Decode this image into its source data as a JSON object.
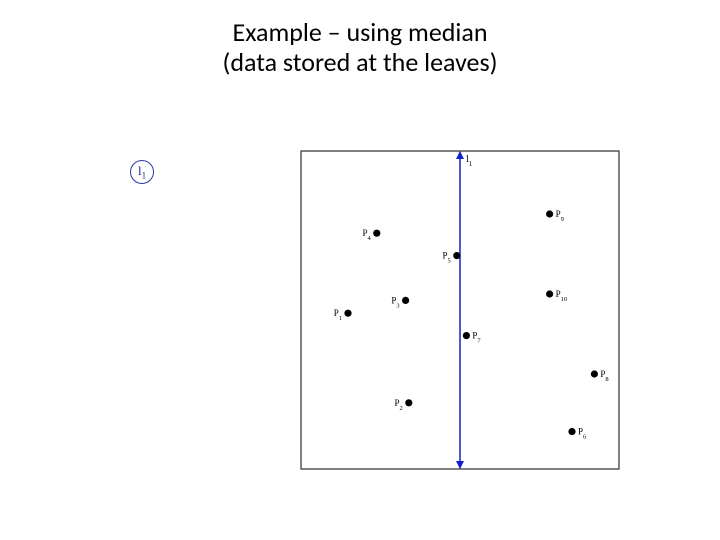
{
  "title_line1": "Example – using median",
  "title_line2": "(data stored at the leaves)",
  "tree": {
    "root_label_main": "l",
    "root_label_sub": "1"
  },
  "chart_data": {
    "type": "scatter",
    "title": "",
    "xlabel": "",
    "ylabel": "",
    "xlim": [
      0,
      100
    ],
    "ylim": [
      0,
      100
    ],
    "splits": [
      {
        "name": "l1",
        "axis": "x",
        "value": 50,
        "label_main": "l",
        "label_sub": "1"
      }
    ],
    "points": [
      {
        "name": "P1",
        "x": 15,
        "y": 49,
        "label_main": "P",
        "label_sub": "1",
        "label_side": "left"
      },
      {
        "name": "P2",
        "x": 34,
        "y": 21,
        "label_main": "P",
        "label_sub": "2",
        "label_side": "left"
      },
      {
        "name": "P3",
        "x": 33,
        "y": 53,
        "label_main": "P",
        "label_sub": "3",
        "label_side": "left"
      },
      {
        "name": "P4",
        "x": 24,
        "y": 74,
        "label_main": "P",
        "label_sub": "4",
        "label_side": "left"
      },
      {
        "name": "P5",
        "x": 49,
        "y": 67,
        "label_main": "P",
        "label_sub": "5",
        "label_side": "left"
      },
      {
        "name": "P6",
        "x": 85,
        "y": 12,
        "label_main": "P",
        "label_sub": "6",
        "label_side": "right"
      },
      {
        "name": "P7",
        "x": 52,
        "y": 42,
        "label_main": "P",
        "label_sub": "7",
        "label_side": "right"
      },
      {
        "name": "P8",
        "x": 92,
        "y": 30,
        "label_main": "P",
        "label_sub": "8",
        "label_side": "right"
      },
      {
        "name": "P9",
        "x": 78,
        "y": 80,
        "label_main": "P",
        "label_sub": "9",
        "label_side": "right"
      },
      {
        "name": "P10",
        "x": 78,
        "y": 55,
        "label_main": "P",
        "label_sub": "10",
        "label_side": "right"
      }
    ]
  }
}
